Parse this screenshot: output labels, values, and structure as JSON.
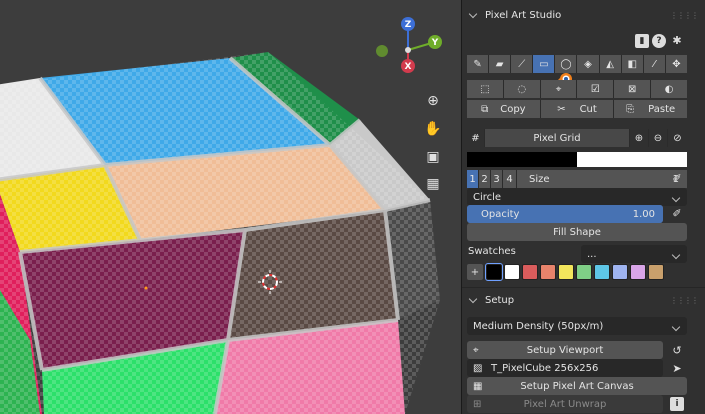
{
  "panel": {
    "title": "Pixel Art Studio",
    "tool_icons": [
      "brush-icon",
      "eraser-icon",
      "line-icon",
      "rectangle-icon",
      "ellipse-icon",
      "fill-icon",
      "lasso-icon",
      "dither-icon",
      "eyedropper-icon",
      "move-icon"
    ],
    "select_icons": [
      "select-rect-icon",
      "select-ellipse-icon",
      "select-lasso-icon",
      "select-all-icon",
      "deselect-icon",
      "invert-selection-icon"
    ],
    "copy_label": "Copy",
    "cut_label": "Cut",
    "paste_label": "Paste",
    "grid_label": "Pixel Grid",
    "sizes": [
      "1",
      "2",
      "3",
      "4"
    ],
    "size_label": "Size",
    "size_value": "1",
    "shape_value": "Circle",
    "opacity_label": "Opacity",
    "opacity_value": "1.00",
    "opacity_fraction": 1.0,
    "fill_shape_label": "Fill Shape",
    "swatches_label": "Swatches",
    "swatches_dropdown": "...",
    "swatch_colors": [
      "#000000",
      "#ffffff",
      "#d95c5c",
      "#e8836b",
      "#f2e55c",
      "#7fcf86",
      "#5ec6e6",
      "#9fb4f0",
      "#d9a5e8",
      "#c9a06c"
    ],
    "setup_title": "Setup",
    "density_value": "Medium Density (50px/m)",
    "setup_viewport_label": "Setup Viewport",
    "texture_name": "T_PixelCube  256x256",
    "setup_canvas_label": "Setup Pixel Art Canvas",
    "unwrap_label": "Pixel Art Unwrap"
  },
  "viewport": {
    "gizmo_labels": {
      "z": "Z",
      "y": "Y",
      "x": "X"
    }
  }
}
